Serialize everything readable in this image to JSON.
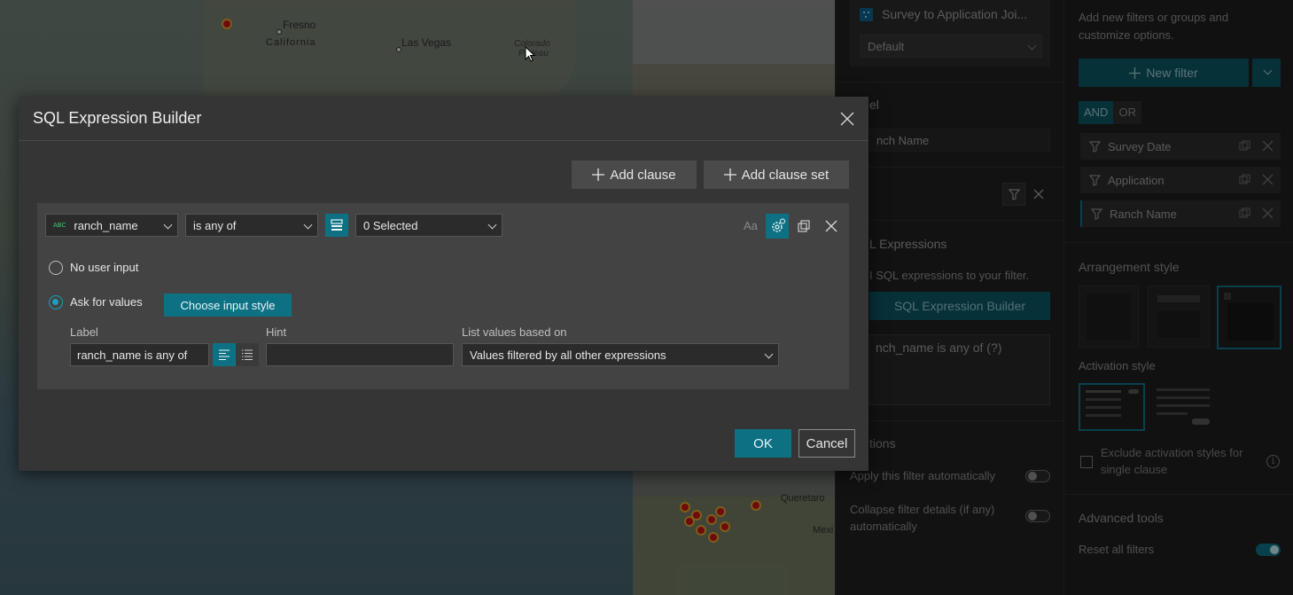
{
  "map": {
    "labels": {
      "fresno": "Fresno",
      "california": "California",
      "las_vegas": "Las Vegas",
      "colorado": "Colorado",
      "plateau": "Plateau",
      "queretaro": "Queretaro",
      "mexico": "Mexi"
    }
  },
  "mid_panel": {
    "source_name": "Survey to Application Joi...",
    "source_view": "Default",
    "label_heading": "el",
    "label_value": "nch Name",
    "sql_heading": "L Expressions",
    "sql_desc": "I SQL expressions to your filter.",
    "sql_builder_button": "SQL Expression Builder",
    "sql_text": "nch_name is any of (?)",
    "options_heading": "tions",
    "apply_auto": "Apply this filter automatically",
    "collapse_details": "Collapse filter details (if any) automatically"
  },
  "right_panel": {
    "intro": "Add new filters or groups and customize options.",
    "new_filter": "New filter",
    "and": "AND",
    "or": "OR",
    "filters": [
      "Survey Date",
      "Application",
      "Ranch Name"
    ],
    "arrangement_heading": "Arrangement style",
    "activation_heading": "Activation style",
    "exclude_label": "Exclude activation styles for single clause",
    "advanced_heading": "Advanced tools",
    "reset_all": "Reset all filters"
  },
  "dialog": {
    "title": "SQL Expression Builder",
    "add_clause": "Add clause",
    "add_clause_set": "Add clause set",
    "field_type_badge": "ABC",
    "field": "ranch_name",
    "operator": "is any of",
    "value": "0 Selected",
    "case_toggle": "Aa",
    "no_user_input": "No user input",
    "ask_for_values": "Ask for values",
    "choose_input_style": "Choose input style",
    "label_caption": "Label",
    "label_value": "ranch_name is any of",
    "hint_caption": "Hint",
    "hint_value": "",
    "list_caption": "List values based on",
    "list_value": "Values filtered by all other expressions",
    "ok": "OK",
    "cancel": "Cancel"
  },
  "colors": {
    "accent": "#0e7183",
    "accent_bright": "#17a3bb",
    "dialog_bg": "#353535",
    "clause_bg": "#434343"
  }
}
